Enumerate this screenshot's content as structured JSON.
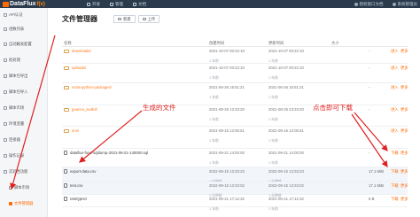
{
  "app": {
    "logo_text": "DataFlux",
    "logo_suffix": "f(x)"
  },
  "topnav": {
    "items": [
      {
        "label": "开发",
        "icon": "code-icon"
      },
      {
        "label": "管理",
        "icon": "manage-icon"
      },
      {
        "label": "文档",
        "icon": "doc-icon"
      }
    ]
  },
  "topright": {
    "items": [
      {
        "label": "授权接口文档",
        "icon": "book-icon"
      },
      {
        "label": "系统管理员",
        "icon": "user-icon"
      }
    ]
  },
  "sidebar": {
    "items": [
      {
        "label": "API认证",
        "icon": "key-icon"
      },
      {
        "label": "函数列表",
        "icon": "list-icon"
      },
      {
        "label": "自动触发配置",
        "icon": "clock-icon"
      },
      {
        "label": "批处理",
        "icon": "batch-icon"
      },
      {
        "label": "脚本包导出",
        "icon": "export-icon"
      },
      {
        "label": "脚本包导入",
        "icon": "import-icon"
      },
      {
        "label": "脚本市场",
        "icon": "market-icon"
      },
      {
        "label": "环境变量",
        "icon": "variable-icon"
      },
      {
        "label": "连接器",
        "icon": "connector-icon"
      },
      {
        "label": "操作记录",
        "icon": "record-icon"
      },
      {
        "label": "实验性功能",
        "icon": "flask-icon"
      },
      {
        "label": "脚本市场",
        "icon": "market-icon"
      },
      {
        "label": "文件管理器",
        "icon": "folder-icon"
      }
    ]
  },
  "page": {
    "title": "文件管理器"
  },
  "toolbar": {
    "buttons": [
      {
        "label": "新建",
        "icon": "folder-plus-icon"
      },
      {
        "label": "上传",
        "icon": "upload-icon"
      }
    ]
  },
  "table": {
    "columns": [
      "名称",
      "创建时间",
      "更新时间",
      "大小"
    ],
    "rows": [
      {
        "name": "downloads/",
        "type": "folder",
        "created": "2021-10-07 00:22:10",
        "created_rel": "1 年前",
        "updated": "2021-10-07 00:22:10",
        "updated_rel": "1 年前",
        "size": "-",
        "actions": [
          "进入",
          "更多"
        ]
      },
      {
        "name": "uploads/",
        "type": "folder",
        "created": "2021-10-07 00:22:10",
        "created_rel": "1 年前",
        "updated": "2021-10-07 00:22:10",
        "updated_rel": "1 年前",
        "size": "-",
        "actions": [
          "进入",
          "更多"
        ]
      },
      {
        "name": "extra-python-packages/",
        "type": "folder",
        "created": "2021-06-26 15:51:21",
        "created_rel": "1 年前",
        "updated": "2021-06-26 15:51:21",
        "updated_rel": "1 年前",
        "size": "-",
        "actions": [
          "进入",
          "更多"
        ]
      },
      {
        "name": "guance_toolkit/",
        "type": "folder",
        "created": "2021-08-25 13:33:20",
        "created_rel": "1 年前",
        "updated": "2021-08-25 13:33:20",
        "updated_rel": "1 年前",
        "size": "-",
        "actions": [
          "进入",
          "更多"
        ]
      },
      {
        "name": "env/",
        "type": "folder",
        "created": "2021-09-15 12:06:51",
        "created_rel": "1 年前",
        "updated": "2021-09-15 12:06:51",
        "updated_rel": "1 年前",
        "size": "-",
        "actions": [
          "进入",
          "更多"
        ]
      },
      {
        "name": "dataflux-func-sqldump-2021-09-21-140000.sql",
        "type": "file",
        "created": "2021-09-21 14:00:00",
        "created_rel": "1 年前",
        "updated": "2021-09-21 14:00:00",
        "updated_rel": "1 年前",
        "size": "-",
        "actions": [
          "下载",
          "更多"
        ]
      },
      {
        "name": "export-data.csv",
        "type": "file",
        "created": "2022-09-15 13:33:23",
        "created_rel": "1 分钟前",
        "updated": "2022-09-15 13:33:23",
        "updated_rel": "1 分钟前",
        "size": "17.1 MiB",
        "actions": [
          "下载",
          "更多"
        ]
      },
      {
        "name": "test.csv",
        "type": "file",
        "created": "2022-09-15 13:33:02",
        "created_rel": "1 分钟前",
        "updated": "2022-09-15 13:33:02",
        "updated_rel": "1 分钟前",
        "size": "17.1 MiB",
        "actions": [
          "下载",
          "更多"
        ]
      },
      {
        "name": "txWQpHd",
        "type": "file",
        "created": "2021-06-21 17:12:32",
        "created_rel": "1 年前",
        "updated": "2021-06-21 17:12:32",
        "updated_rel": "1 年前",
        "size": "5 B",
        "actions": [
          "下载",
          "更多"
        ]
      }
    ]
  },
  "annotations": {
    "generated": "生成的文件",
    "click_download": "点击即可下载",
    "color": "#e02020"
  },
  "colors": {
    "accent": "#ff6a00",
    "topbar": "#2b3a4d"
  }
}
